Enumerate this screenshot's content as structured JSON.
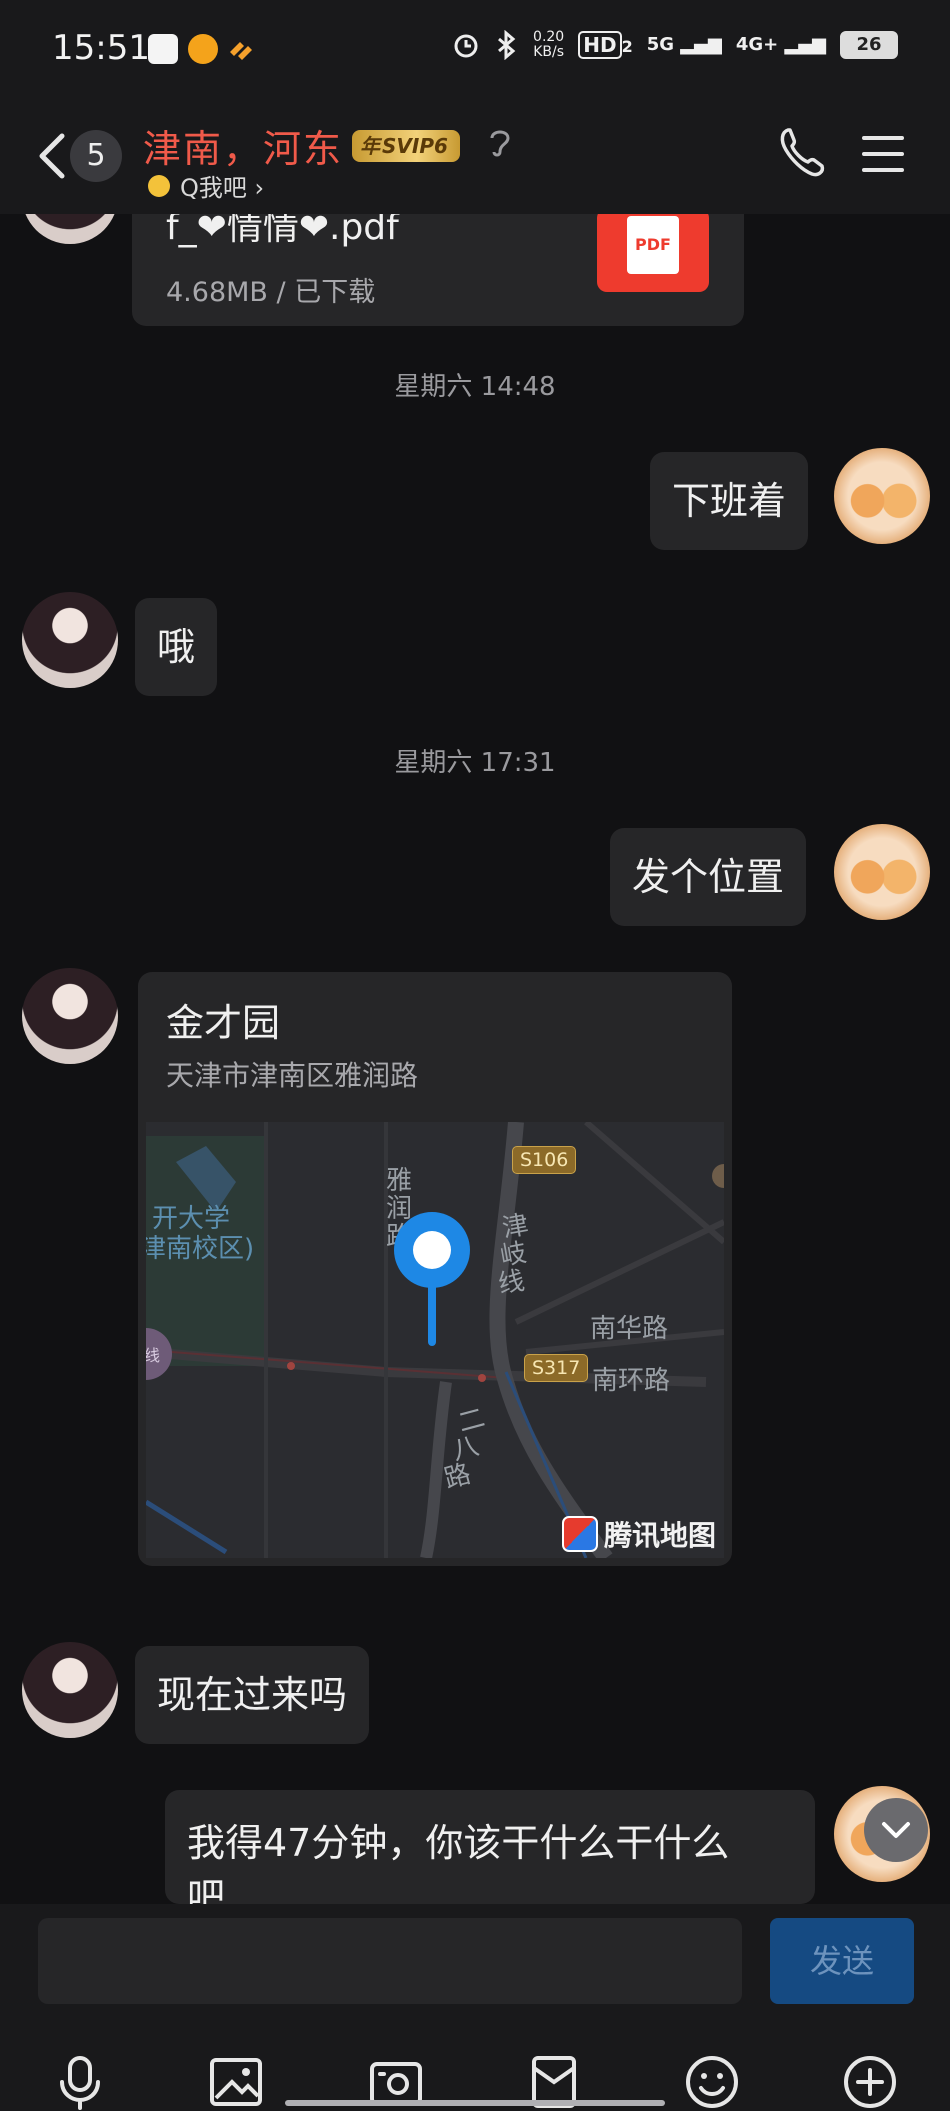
{
  "status_bar": {
    "time": "15:51",
    "net_speed_value": "0.20",
    "net_speed_unit": "KB/s",
    "hd_label": "HD",
    "hd_sub": "2",
    "sig5g": "5G",
    "sig4g": "4G+",
    "battery": "26"
  },
  "header": {
    "unread_count": "5",
    "chat_name": "津南，河东",
    "svip_label": "SVIP6",
    "svip_prefix": "年",
    "subtitle": "Q我吧 ›"
  },
  "messages": {
    "file": {
      "name": "f_❤情情❤.pdf",
      "meta": "4.68MB / 已下载",
      "icon_label": "PDF"
    },
    "timestamp1": "星期六 14:48",
    "msg1": "下班着",
    "msg2": "哦",
    "timestamp2": "星期六 17:31",
    "msg3": "发个位置",
    "location": {
      "title": "金才园",
      "address": "天津市津南区雅润路",
      "map_labels": {
        "school_1": "开大学",
        "school_2": "津南校区)",
        "road_yarun_1": "雅",
        "road_yarun_2": "润",
        "road_yarun_3": "路",
        "road_jinqi_1": "津",
        "road_jinqi_2": "岐",
        "road_jinqi_3": "线",
        "s106": "S106",
        "nanhua": "南华路",
        "s317": "S317",
        "nanhuan": "南环路",
        "erba_1": "二",
        "erba_2": "八",
        "erba_3": "路",
        "xian": "线"
      },
      "map_brand": "腾讯地图"
    },
    "msg4": "现在过来吗",
    "msg5_line1": "我得47分钟，你该干什么干什么",
    "msg5_line2": "吧"
  },
  "input": {
    "send_label": "发送",
    "placeholder": ""
  },
  "colors": {
    "background": "#111113",
    "bubble": "#262628",
    "name_red": "#f05a4a",
    "send_button": "#154a82",
    "map_pin": "#1e88e5"
  }
}
